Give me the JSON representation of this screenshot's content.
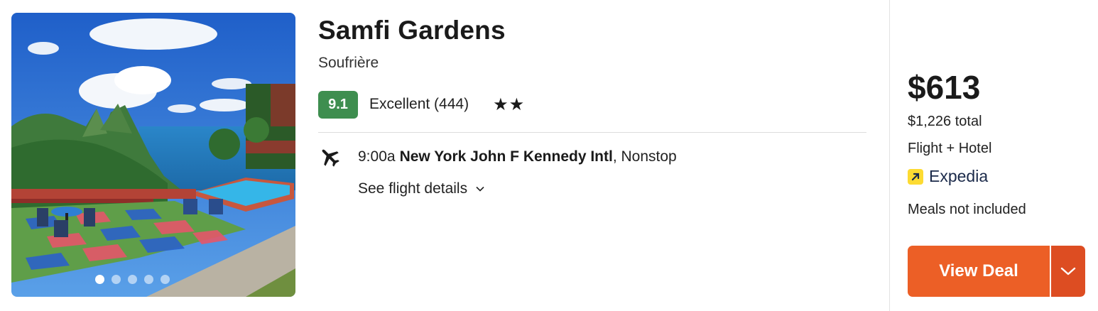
{
  "hotel": {
    "name": "Samfi Gardens",
    "location": "Soufrière",
    "score": "9.1",
    "rating_text": "Excellent (444)",
    "stars": "★★"
  },
  "photo": {
    "count": 5,
    "active_index": 0
  },
  "flight": {
    "icon": "airplane-icon",
    "time": "9:00a",
    "airport": "New York John F Kennedy Intl",
    "type": ", Nonstop",
    "details_label": "See flight details"
  },
  "pricing": {
    "price": "$613",
    "total": "$1,226 total",
    "package": "Flight + Hotel",
    "provider": "Expedia",
    "meals": "Meals not included",
    "deal_label": "View Deal"
  },
  "colors": {
    "score_badge": "#3e8e4f",
    "deal_button": "#ec5f26",
    "deal_dropdown": "#dd4d22",
    "provider_logo": "#fddb32"
  }
}
